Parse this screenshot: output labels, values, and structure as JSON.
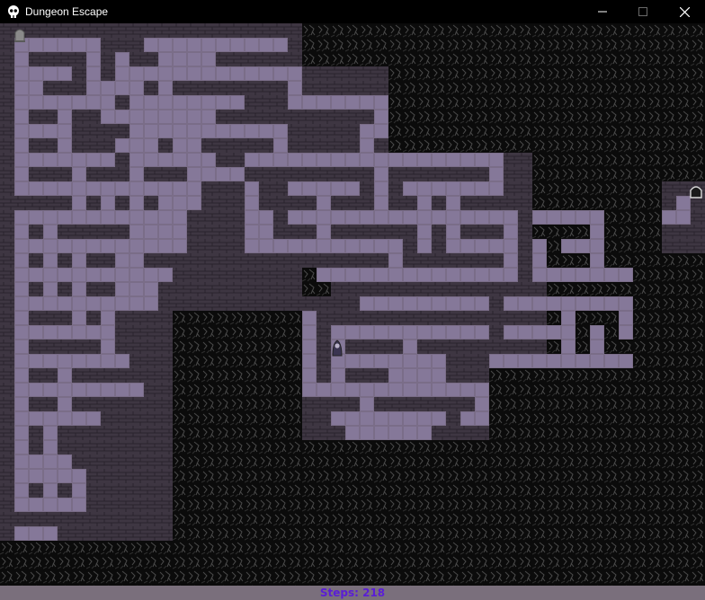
{
  "window": {
    "title": "Dungeon Escape",
    "icon": "skull-icon",
    "controls": [
      "minimize-icon",
      "maximize-icon",
      "close-icon"
    ]
  },
  "status": {
    "steps_label": "Steps:",
    "steps_value": "218"
  },
  "colors": {
    "void": "#0b0b0b",
    "void_pattern": "#4a4a4a",
    "wall": "#3e3642",
    "wall_brick_line": "#2a242d",
    "floor": "#7a6d88",
    "floor_inner": "#857899",
    "statusbar": "#7a6f7c",
    "steps_text": "#5a1dd6"
  },
  "entities": {
    "player": "hooded-player-icon",
    "entrance": "tombstone-entrance-icon",
    "exit": "arched-exit-door-icon"
  }
}
